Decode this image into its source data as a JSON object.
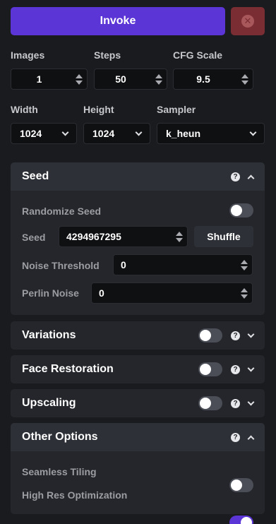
{
  "toolbar": {
    "invoke_label": "Invoke",
    "cancel_icon": "close-circle-icon"
  },
  "params": {
    "images": {
      "label": "Images",
      "value": "1"
    },
    "steps": {
      "label": "Steps",
      "value": "50"
    },
    "cfg_scale": {
      "label": "CFG Scale",
      "value": "9.5"
    },
    "width": {
      "label": "Width",
      "value": "1024"
    },
    "height": {
      "label": "Height",
      "value": "1024"
    },
    "sampler": {
      "label": "Sampler",
      "value": "k_heun"
    }
  },
  "seed_panel": {
    "title": "Seed",
    "expanded": true,
    "randomize_label": "Randomize Seed",
    "randomize_on": false,
    "seed_label": "Seed",
    "seed_value": "4294967295",
    "shuffle_label": "Shuffle",
    "noise_threshold_label": "Noise Threshold",
    "noise_threshold_value": "0",
    "perlin_noise_label": "Perlin Noise",
    "perlin_noise_value": "0"
  },
  "variations_panel": {
    "title": "Variations",
    "enabled": false
  },
  "face_restoration_panel": {
    "title": "Face Restoration",
    "enabled": false
  },
  "upscaling_panel": {
    "title": "Upscaling",
    "enabled": false
  },
  "other_options_panel": {
    "title": "Other Options",
    "expanded": true,
    "seamless_tiling_label": "Seamless Tiling",
    "seamless_tiling_on": false,
    "high_res_label": "High Res Optimization",
    "high_res_on": true
  },
  "help_glyph": "?",
  "colors": {
    "background": "#1a1b1f",
    "accent": "#5b35d5",
    "cancel": "#7a2e33",
    "panel": "#24262b",
    "panel_header": "#2d3036",
    "input_bg": "#0f1012"
  }
}
